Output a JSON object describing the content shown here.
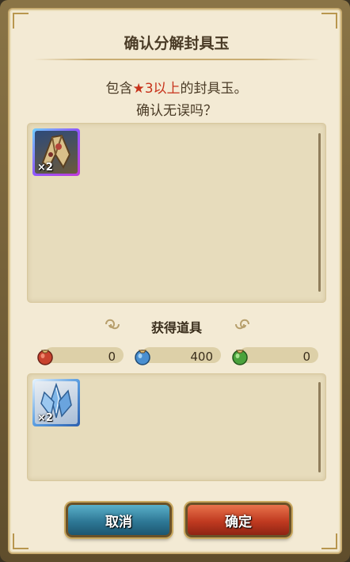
{
  "dialog": {
    "title": "确认分解封具玉",
    "message_prefix": "包含",
    "message_highlight": "★3以上",
    "message_suffix": "的封具玉。",
    "message_line2": "确认无误吗？"
  },
  "selected_items": [
    {
      "icon": "armor-piece-icon",
      "count": "×2"
    }
  ],
  "obtain": {
    "title": "获得道具",
    "resources": [
      {
        "icon": "red-gem-pouch-icon",
        "value": "0",
        "color": "#c8422e"
      },
      {
        "icon": "blue-gem-pouch-icon",
        "value": "400",
        "color": "#4a8fd0"
      },
      {
        "icon": "green-gem-pouch-icon",
        "value": "0",
        "color": "#4aa23c"
      }
    ],
    "items": [
      {
        "icon": "ice-crystal-icon",
        "count": "×2"
      }
    ]
  },
  "buttons": {
    "cancel": "取消",
    "confirm": "确定"
  }
}
